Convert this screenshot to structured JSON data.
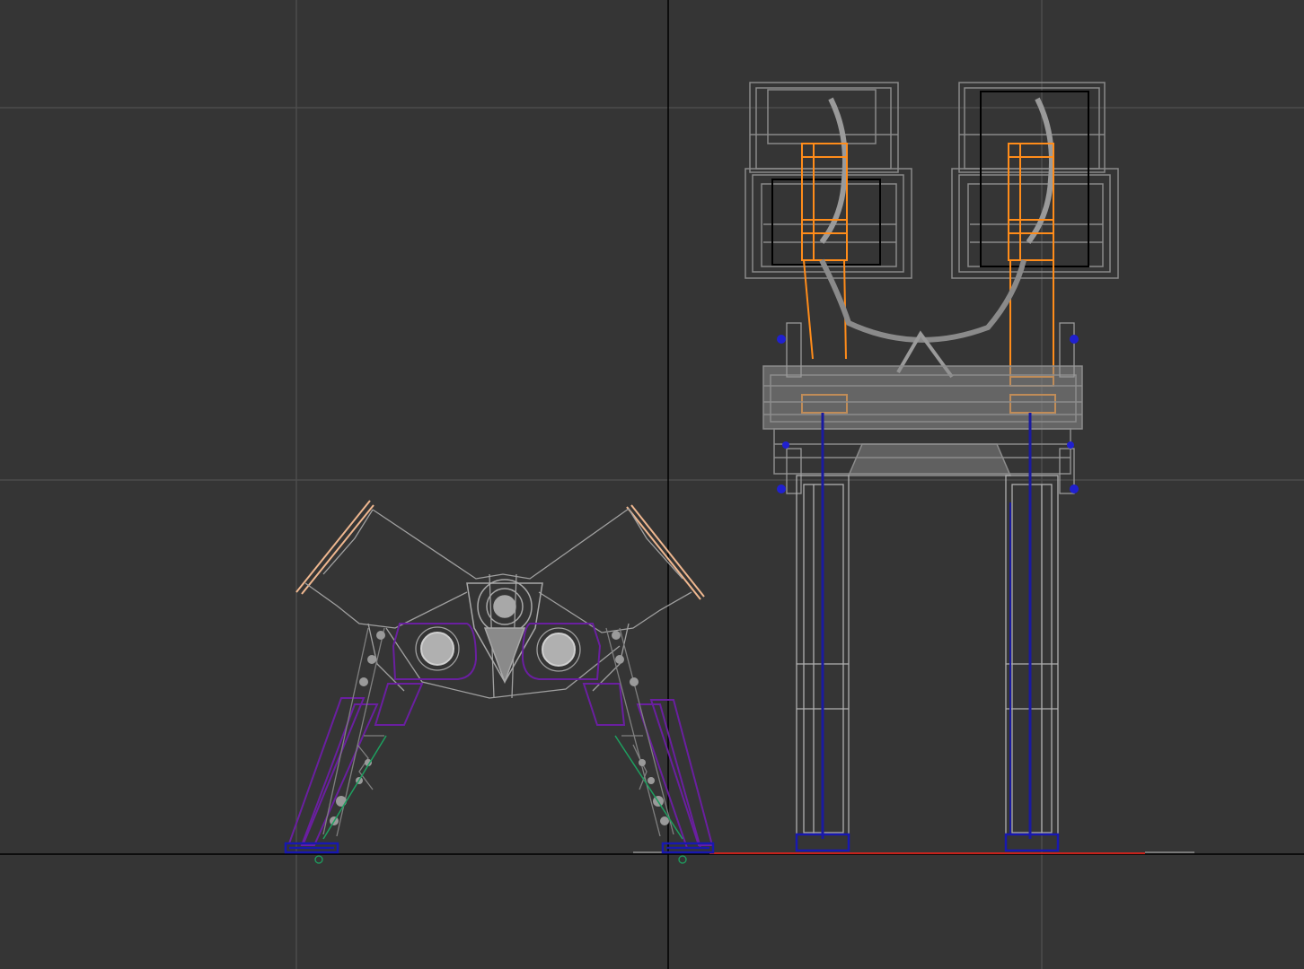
{
  "viewport": {
    "background": "#353535",
    "grid_color": "#4d4d4d",
    "axis_color": "#000000",
    "ground_line_color": "#e0241c",
    "projection": "orthographic"
  },
  "objects": {
    "walker_side_view": {
      "kind": "mech walker wireframe",
      "view": "side",
      "colors": {
        "body": "#9a9a9a",
        "thigh_armor": "#6a1fa0",
        "pistons": "#7a7a7a",
        "hydraulic_line": "#1ea060",
        "toe_plates": "#1818b0",
        "hip_panels": "#f0b890"
      }
    },
    "walker_front_view": {
      "kind": "mech walker wireframe",
      "view": "front",
      "colors": {
        "body": "#8c8c8c",
        "leg_struts": "#1a1aa0",
        "leg_frame": "#b0b0b0",
        "pods": "#8a8a8a",
        "pod_core": "#ff8c1a",
        "bolts": "#2020d0"
      }
    }
  }
}
